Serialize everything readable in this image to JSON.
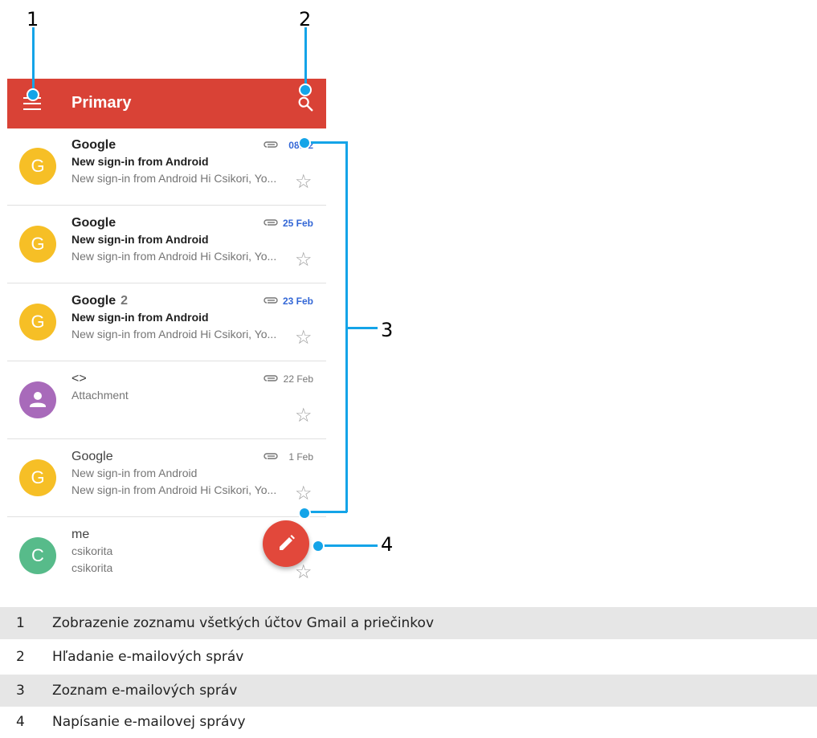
{
  "callouts": [
    "1",
    "2",
    "3",
    "4"
  ],
  "appbar": {
    "title": "Primary"
  },
  "emails": [
    {
      "sender": "Google",
      "count": "",
      "subject": "New sign-in from Android",
      "snippet": "New sign-in from Android Hi Csikori, Yo...",
      "date": "08:52",
      "avatar": "G",
      "avatar_color": "#f6bf26",
      "unread": true,
      "attachment": true
    },
    {
      "sender": "Google",
      "count": "",
      "subject": "New sign-in from Android",
      "snippet": "New sign-in from Android Hi Csikori, Yo...",
      "date": "25 Feb",
      "avatar": "G",
      "avatar_color": "#f6bf26",
      "unread": true,
      "attachment": true
    },
    {
      "sender": "Google",
      "count": "2",
      "subject": "New sign-in from Android",
      "snippet": "New sign-in from Android Hi Csikori, Yo...",
      "date": "23 Feb",
      "avatar": "G",
      "avatar_color": "#f6bf26",
      "unread": true,
      "attachment": true
    },
    {
      "sender": "<>",
      "count": "",
      "subject": "Attachment",
      "snippet": "",
      "date": "22 Feb",
      "avatar": "person-icon",
      "avatar_color": "#a86aba",
      "unread": false,
      "attachment": true
    },
    {
      "sender": "Google",
      "count": "",
      "subject": "New sign-in from Android",
      "snippet": "New sign-in from Android Hi Csikori, Yo...",
      "date": "1 Feb",
      "avatar": "G",
      "avatar_color": "#f6bf26",
      "unread": false,
      "attachment": true
    },
    {
      "sender": "me",
      "count": "",
      "subject": "csikorita",
      "snippet": "csikorita",
      "date": "",
      "avatar": "C",
      "avatar_color": "#57bb8a",
      "unread": false,
      "attachment": false
    }
  ],
  "fab": {
    "icon": "pencil-icon",
    "color": "#e2483b"
  },
  "accent_color": "#14a4e8",
  "legend": [
    {
      "num": "1",
      "text": "Zobrazenie zoznamu všetkých účtov Gmail a priečinkov"
    },
    {
      "num": "2",
      "text": "Hľadanie e-mailových správ"
    },
    {
      "num": "3",
      "text": "Zoznam e-mailových správ"
    },
    {
      "num": "4",
      "text": "Napísanie e-mailovej správy"
    }
  ]
}
